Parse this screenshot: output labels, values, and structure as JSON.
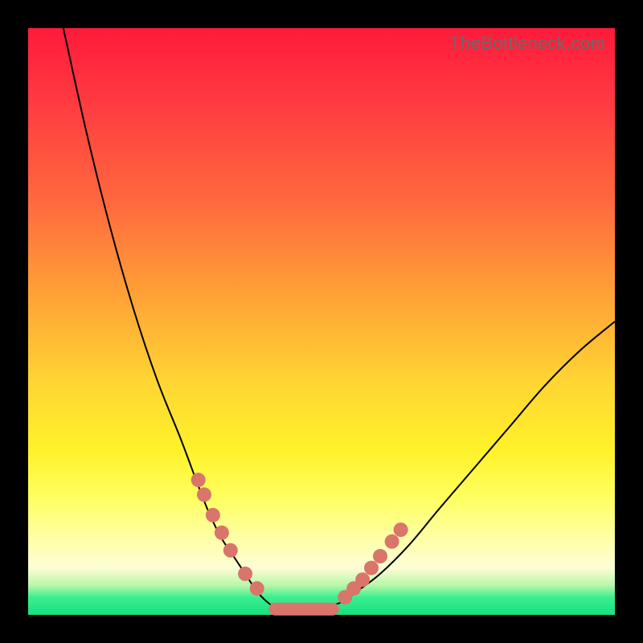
{
  "watermark": "TheBottleneck.com",
  "colors": {
    "frame": "#000000",
    "dot": "#d9756a",
    "curve": "#000000",
    "gradient_stops": [
      "#ff1a3b",
      "#ff3940",
      "#ff6a3e",
      "#ffa036",
      "#ffd433",
      "#fff22a",
      "#ffff60",
      "#ffffb0",
      "#fdfdd6",
      "#b6f7a8",
      "#3bef90",
      "#17e07f"
    ]
  },
  "chart_data": {
    "type": "line",
    "title": "",
    "xlabel": "",
    "ylabel": "",
    "xlim": [
      0,
      100
    ],
    "ylim": [
      0,
      100
    ],
    "series": [
      {
        "name": "bottleneck-curve",
        "x": [
          6,
          10,
          14,
          18,
          22,
          26,
          29,
          31,
          33,
          35,
          37,
          39,
          41,
          43,
          48,
          53,
          56,
          60,
          65,
          70,
          76,
          82,
          88,
          94,
          100
        ],
        "y": [
          100,
          82,
          66,
          52,
          40,
          30,
          22,
          17,
          13,
          10,
          7,
          4,
          2,
          1,
          1,
          2,
          4,
          7,
          12,
          18,
          25,
          32,
          39,
          45,
          50
        ]
      }
    ],
    "markers": {
      "name": "highlight-dots",
      "x": [
        29.0,
        30.0,
        31.5,
        33.0,
        34.5,
        37.0,
        39.0,
        54.0,
        55.5,
        57.0,
        58.5,
        60.0,
        62.0,
        63.5
      ],
      "y": [
        23.0,
        20.5,
        17.0,
        14.0,
        11.0,
        7.0,
        4.5,
        3.0,
        4.5,
        6.0,
        8.0,
        10.0,
        12.5,
        14.5
      ],
      "radius": 9
    },
    "bottom_bar": {
      "name": "flat-minimum",
      "x_start": 41,
      "x_end": 53,
      "y": 1,
      "thickness": 16
    }
  }
}
